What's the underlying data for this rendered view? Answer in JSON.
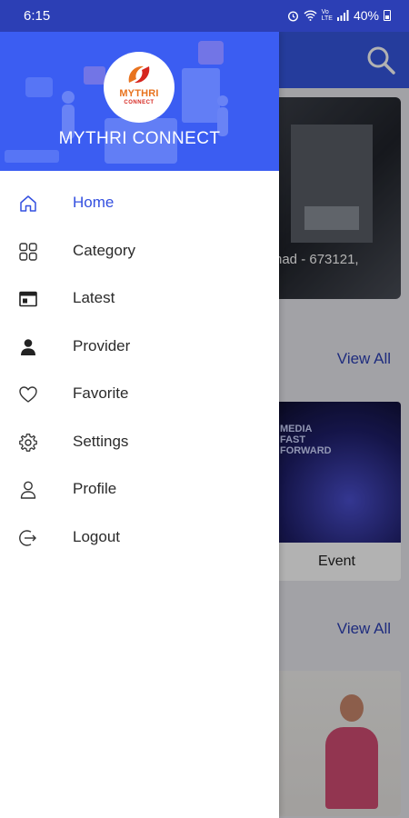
{
  "status_bar": {
    "time": "6:15",
    "battery": "40%",
    "icons": [
      "alarm-icon",
      "wifi-icon",
      "volte-icon",
      "signal-icon",
      "battery-icon"
    ]
  },
  "drawer": {
    "brand_name": "MYTHRI CONNECT",
    "logo_word": "MYTHRI",
    "logo_sub": "CONNECT",
    "items": [
      {
        "label": "Home",
        "icon": "home-icon",
        "active": true
      },
      {
        "label": "Category",
        "icon": "grid-icon",
        "active": false
      },
      {
        "label": "Latest",
        "icon": "calendar-icon",
        "active": false
      },
      {
        "label": "Provider",
        "icon": "person-filled-icon",
        "active": false
      },
      {
        "label": "Favorite",
        "icon": "heart-icon",
        "active": false
      },
      {
        "label": "Settings",
        "icon": "gear-icon",
        "active": false
      },
      {
        "label": "Profile",
        "icon": "person-outline-icon",
        "active": false
      },
      {
        "label": "Logout",
        "icon": "logout-icon",
        "active": false
      }
    ]
  },
  "background": {
    "banner_text": "nad - 673121,",
    "section_1_link": "View All",
    "card_1_label": "Event",
    "card_1_image_text": "MEDIA FAST FORWARD",
    "section_2_link": "View All"
  },
  "colors": {
    "accent": "#3b5df2",
    "active_text": "#3450e0",
    "status_bar": "#2c3fb5"
  }
}
